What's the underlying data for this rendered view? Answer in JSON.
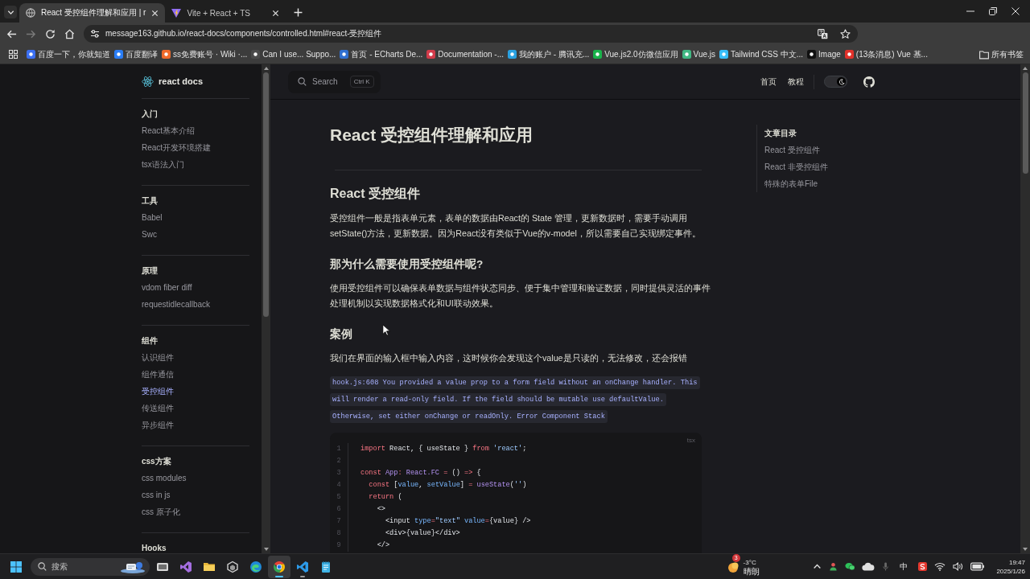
{
  "browser": {
    "tabs": [
      {
        "title": "React 受控组件理解和应用 | r",
        "selected": true
      },
      {
        "title": "Vite + React + TS",
        "selected": false
      }
    ],
    "url": "message163.github.io/react-docs/components/controlled.html#react-受控组件",
    "bookmarks": [
      "百度一下，你就知道",
      "百度翻译",
      "ss免费账号 · Wiki ·...",
      "Can I use... Suppo...",
      "首页 - ECharts De...",
      "Documentation -...",
      "我的账户 - 腾讯充...",
      "Vue.js2.0仿微信应用",
      "Vue.js",
      "Tailwind CSS 中文...",
      "Image",
      "(13条消息) Vue 基..."
    ],
    "all_bookmarks": "所有书签"
  },
  "site": {
    "title": "react docs"
  },
  "sidebar": {
    "groups": [
      {
        "title": "入门",
        "items": [
          {
            "label": "React基本介绍",
            "selected": false
          },
          {
            "label": "React开发环境搭建",
            "selected": false
          },
          {
            "label": "tsx语法入门",
            "selected": false
          }
        ]
      },
      {
        "title": "工具",
        "items": [
          {
            "label": "Babel",
            "selected": false
          },
          {
            "label": "Swc",
            "selected": false
          }
        ]
      },
      {
        "title": "原理",
        "items": [
          {
            "label": "vdom fiber diff",
            "selected": false
          },
          {
            "label": "requestidlecallback",
            "selected": false
          }
        ]
      },
      {
        "title": "组件",
        "items": [
          {
            "label": "认识组件",
            "selected": false
          },
          {
            "label": "组件通信",
            "selected": false
          },
          {
            "label": "受控组件",
            "selected": true
          },
          {
            "label": "传送组件",
            "selected": false
          },
          {
            "label": "异步组件",
            "selected": false
          }
        ]
      },
      {
        "title": "css方案",
        "items": [
          {
            "label": "css modules",
            "selected": false
          },
          {
            "label": "css in js",
            "selected": false
          },
          {
            "label": "css 原子化",
            "selected": false
          }
        ]
      },
      {
        "title": "Hooks"
      }
    ]
  },
  "header": {
    "search": {
      "label": "Search",
      "shortcut": "Ctrl K"
    },
    "nav": [
      "首页",
      "教程"
    ],
    "dark_mode": true
  },
  "article": {
    "title": "React 受控组件理解和应用",
    "blocks": [
      {
        "kind": "h2",
        "text": "React 受控组件"
      },
      {
        "kind": "p",
        "text": "受控组件一般是指表单元素，表单的数据由React的 State 管理，更新数据时，需要手动调用setState()方法，更新数据。因为React没有类似于Vue的v-model，所以需要自己实现绑定事件。"
      },
      {
        "kind": "h3",
        "text": "那为什么需要使用受控组件呢?"
      },
      {
        "kind": "p",
        "text": "使用受控组件可以确保表单数据与组件状态同步、便于集中管理和验证数据，同时提供灵活的事件处理机制以实现数据格式化和UI联动效果。"
      },
      {
        "kind": "h3",
        "text": "案例"
      },
      {
        "kind": "p",
        "text": "我们在界面的输入框中输入内容，这时候你会发现这个value是只读的，无法修改，还会报错"
      },
      {
        "kind": "inline-code",
        "text": "hook.js:608 You provided a value prop to a form field without an onChange handler. This will render a read-only field. If the field should be mutable use defaultValue. Otherwise, set either onChange or readOnly. Error Component Stack"
      },
      {
        "kind": "code",
        "lang": "tsx",
        "lines": [
          {
            "number": "1",
            "tokens": [
              {
                "kind": "keyword",
                "text": "import"
              },
              {
                "kind": "plain",
                "text": " React, { useState } "
              },
              {
                "kind": "keyword",
                "text": "from"
              },
              {
                "kind": "string",
                "text": " 'react'"
              },
              {
                "kind": "plain",
                "text": ";"
              }
            ]
          },
          {
            "number": "2"
          },
          {
            "number": "3",
            "tokens": [
              {
                "kind": "keyword",
                "text": "const"
              },
              {
                "kind": "type",
                "text": " App"
              },
              {
                "kind": "keyword",
                "text": ":"
              },
              {
                "kind": "type",
                "text": " React.FC"
              },
              {
                "kind": "keyword",
                "text": " ="
              },
              {
                "kind": "plain",
                "text": " () "
              },
              {
                "kind": "keyword",
                "text": "=>"
              },
              {
                "kind": "plain",
                "text": " {"
              }
            ]
          },
          {
            "number": "4",
            "tokens": [
              {
                "kind": "keyword",
                "text": "  const"
              },
              {
                "kind": "plain",
                "text": " ["
              },
              {
                "kind": "variable",
                "text": "value"
              },
              {
                "kind": "plain",
                "text": ", "
              },
              {
                "kind": "variable",
                "text": "setValue"
              },
              {
                "kind": "plain",
                "text": "] "
              },
              {
                "kind": "keyword",
                "text": "="
              },
              {
                "kind": "function",
                "text": " useState"
              },
              {
                "kind": "plain",
                "text": "("
              },
              {
                "kind": "string",
                "text": "''"
              },
              {
                "kind": "plain",
                "text": ")"
              }
            ]
          },
          {
            "number": "5",
            "tokens": [
              {
                "kind": "keyword",
                "text": "  return"
              },
              {
                "kind": "plain",
                "text": " ("
              }
            ]
          },
          {
            "number": "6",
            "tokens": [
              {
                "kind": "plain",
                "text": "    <>"
              }
            ]
          },
          {
            "number": "7",
            "tokens": [
              {
                "kind": "plain",
                "text": "      <input "
              },
              {
                "kind": "attr",
                "text": "type"
              },
              {
                "kind": "keyword",
                "text": "="
              },
              {
                "kind": "string",
                "text": "\"text\""
              },
              {
                "kind": "attr",
                "text": " value"
              },
              {
                "kind": "keyword",
                "text": "="
              },
              {
                "kind": "plain",
                "text": "{value} />"
              }
            ]
          },
          {
            "number": "8",
            "tokens": [
              {
                "kind": "plain",
                "text": "      <div>{value}</div>"
              }
            ]
          },
          {
            "number": "9",
            "tokens": [
              {
                "kind": "plain",
                "text": "    </>"
              }
            ]
          }
        ]
      }
    ]
  },
  "toc": {
    "title": "文章目录",
    "items": [
      "React 受控组件",
      "React 非受控组件",
      "特殊的表单File"
    ]
  },
  "taskbar": {
    "search": {
      "placeholder": "搜索"
    },
    "apps": [
      {
        "kind": "taskview",
        "running": false,
        "active": false
      },
      {
        "kind": "studio",
        "running": false,
        "active": false
      },
      {
        "kind": "folder",
        "running": false,
        "active": false
      },
      {
        "kind": "cube",
        "running": false,
        "active": false
      },
      {
        "kind": "edge",
        "running": false,
        "active": false
      },
      {
        "kind": "chrome",
        "running": true,
        "active": true
      },
      {
        "kind": "vscode",
        "running": true,
        "active": false
      },
      {
        "kind": "notepad",
        "running": false,
        "active": false
      }
    ],
    "weather": {
      "badge": "3",
      "temperature": "-3°C",
      "condition": "晴朗"
    },
    "ime": "中",
    "time": "19:47",
    "date": "2025/1/26"
  }
}
